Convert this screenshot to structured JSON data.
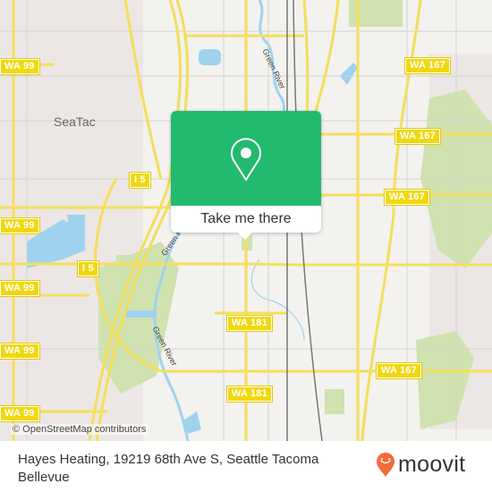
{
  "map": {
    "place_labels": [
      "SeaTac"
    ],
    "river_labels": [
      "Green River",
      "Green River",
      "Green River"
    ],
    "road_shields": [
      "WA 99",
      "WA 167",
      "WA 167",
      "I 5",
      "WA 167",
      "WA 99",
      "I 5",
      "WA 99",
      "WA 181",
      "WA 99",
      "WA 167",
      "WA 181",
      "WA 99"
    ],
    "attribution": "© OpenStreetMap contributors",
    "colors": {
      "background": "#f3f2ef",
      "road": "#f5de5a",
      "water": "#9fd2ee",
      "park": "#cfe2b0",
      "urban": "#ebe6e3",
      "accent": "#22ba6e"
    }
  },
  "popup": {
    "icon": "location-pin-icon",
    "button_label": "Take me there"
  },
  "footer": {
    "address": "Hayes Heating, 19219 68th Ave S, Seattle Tacoma Bellevue",
    "logo_text": "moovit",
    "logo_color": "#f26b3a"
  }
}
